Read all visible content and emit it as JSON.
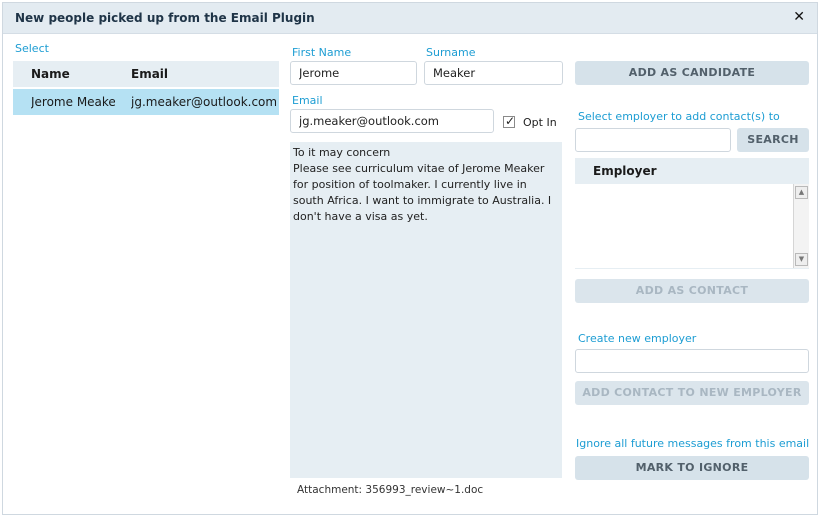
{
  "dialog": {
    "title": "New people picked up from the Email Plugin",
    "close_glyph": "✕"
  },
  "left": {
    "select_label": "Select",
    "columns": {
      "name": "Name",
      "email": "Email"
    },
    "rows": [
      {
        "name": "Jerome Meaker",
        "email": "jg.meaker@outlook.com"
      }
    ]
  },
  "middle": {
    "first_name_label": "First Name",
    "first_name_value": "Jerome",
    "surname_label": "Surname",
    "surname_value": "Meaker",
    "email_label": "Email",
    "email_value": "jg.meaker@outlook.com",
    "opt_in_label": "Opt In",
    "opt_in_checked": true,
    "message": "To it may concern\nPlease see curriculum vitae of Jerome Meaker for position of toolmaker. I currently live in south Africa. I want to immigrate to Australia. I don't have a visa as yet.",
    "attachment_text": "Attachment: 356993_review~1.doc"
  },
  "right": {
    "add_candidate_label": "ADD AS CANDIDATE",
    "select_employer_label": "Select employer to add contact(s) to",
    "employer_search_value": "",
    "search_label": "SEARCH",
    "employer_column": "Employer",
    "add_contact_label": "ADD AS CONTACT",
    "create_employer_label": "Create new employer",
    "new_employer_value": "",
    "add_contact_new_employer_label": "ADD CONTACT TO NEW EMPLOYER",
    "ignore_label": "Ignore all future messages from this email",
    "mark_ignore_label": "MARK TO IGNORE"
  },
  "colors": {
    "accent": "#1d9dd3",
    "selected_row": "#b5e1f3",
    "header_bg": "#e3ebf1",
    "button_bg": "#d6e2ea"
  }
}
